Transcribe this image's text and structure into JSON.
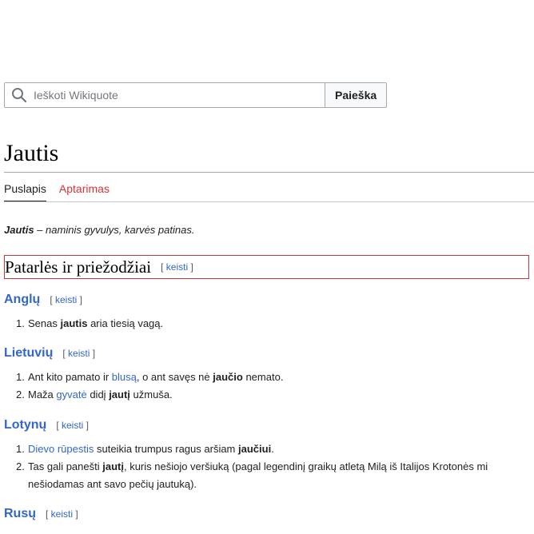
{
  "search": {
    "placeholder": "Ieškoti Wikiquote",
    "button_label": "Paieška",
    "icon": "search-icon"
  },
  "page": {
    "title": "Jautis",
    "tabs": [
      {
        "label": "Puslapis",
        "active": true
      },
      {
        "label": "Aptarimas",
        "active": false,
        "color": "#d73333"
      }
    ]
  },
  "intro": {
    "term": "Jautis",
    "rest": " – naminis gyvulys, karvės patinas."
  },
  "section": {
    "title": "Patarlės ir priežodžiai",
    "edit_label": "keisti"
  },
  "languages": [
    {
      "name": "Anglų",
      "edit_label": "keisti",
      "items": [
        {
          "num": "1.",
          "parts": [
            "Senas ",
            "jautis",
            " aria tiesią vagą."
          ]
        }
      ]
    },
    {
      "name": "Lietuvių",
      "edit_label": "keisti",
      "items": [
        {
          "num": "1.",
          "parts": [
            "Ant kito pamato ir ",
            "blusą",
            ", o ant savęs nė ",
            "jaučio",
            " nemato."
          ]
        },
        {
          "num": "2.",
          "parts": [
            "Maža ",
            "gyvatė",
            " didį ",
            "jautį",
            " užmuša."
          ]
        }
      ]
    },
    {
      "name": "Lotynų",
      "edit_label": "keisti",
      "items": [
        {
          "num": "1.",
          "parts": [
            "Dievo rūpestis",
            " suteikia trumpus ragus aršiam ",
            "jaučiui",
            "."
          ]
        },
        {
          "num": "2.",
          "parts": [
            "Tas gali panešti ",
            "jautį",
            ", kuris nešiojo veršiuką (pagal legendinį graikų atletą Milą iš Italijos Krotonės mi",
            "nešiodamas ant savo pečių jautuką)."
          ]
        }
      ]
    },
    {
      "name": "Rusų",
      "edit_label": "keisti"
    }
  ],
  "colors": {
    "link": "#3366cc",
    "redlink": "#d73333",
    "heading_border": "#c6373a",
    "text": "#202122"
  }
}
